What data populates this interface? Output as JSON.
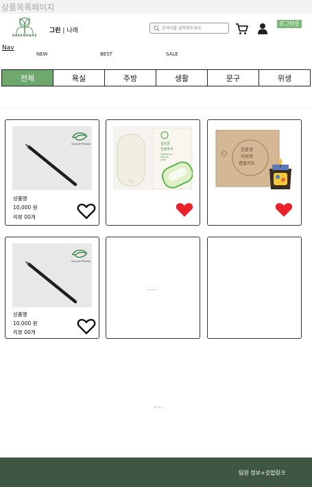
{
  "page": {
    "heading": "상품목록페이지"
  },
  "header": {
    "logo_text": "GREENHARE",
    "brand_bold": "그린",
    "brand_sep": " | ",
    "brand_rest": "나래",
    "search_placeholder": "검색어를 입력해주세요.",
    "logout_label": "로그아웃"
  },
  "nav": {
    "title": "Nav",
    "links": [
      "NEW",
      "BEST",
      "SALE"
    ]
  },
  "tabs": [
    "전체",
    "욕실",
    "주방",
    "생활",
    "문구",
    "위생"
  ],
  "products": [
    {
      "name": "상품명",
      "price": "10,000 원",
      "review": "리뷰 00개",
      "image": "pencil",
      "liked": false,
      "badge": "Upcycle Product"
    },
    {
      "name": "",
      "price": "",
      "review": "",
      "image": "silicone-cover",
      "liked": true,
      "pack_text": [
        "실리콘",
        "전솔주걱",
        "Toothbrush",
        "silicone",
        "cover"
      ]
    },
    {
      "name": "",
      "price": "",
      "review": "",
      "image": "candle-kit",
      "liked": true,
      "box_text": [
        "친환경",
        "커피박",
        "캔들키트"
      ]
    },
    {
      "name": "상품명",
      "price": "10,000 원",
      "review": "리뷰 00개",
      "image": "pencil",
      "liked": false,
      "badge": "Upcycle Product"
    },
    {
      "name": "",
      "price": "",
      "review": "",
      "image": "empty",
      "liked": false,
      "dots": "...."
    },
    {
      "name": "",
      "price": "",
      "review": "",
      "image": "empty",
      "liked": false
    }
  ],
  "grid_more": "....",
  "footer": {
    "text": "팀원 정보+깃헙링크"
  },
  "colors": {
    "accent": "#6fa86d",
    "logout": "#7bb979",
    "footer": "#3f5642",
    "heart": "#e8232a"
  }
}
